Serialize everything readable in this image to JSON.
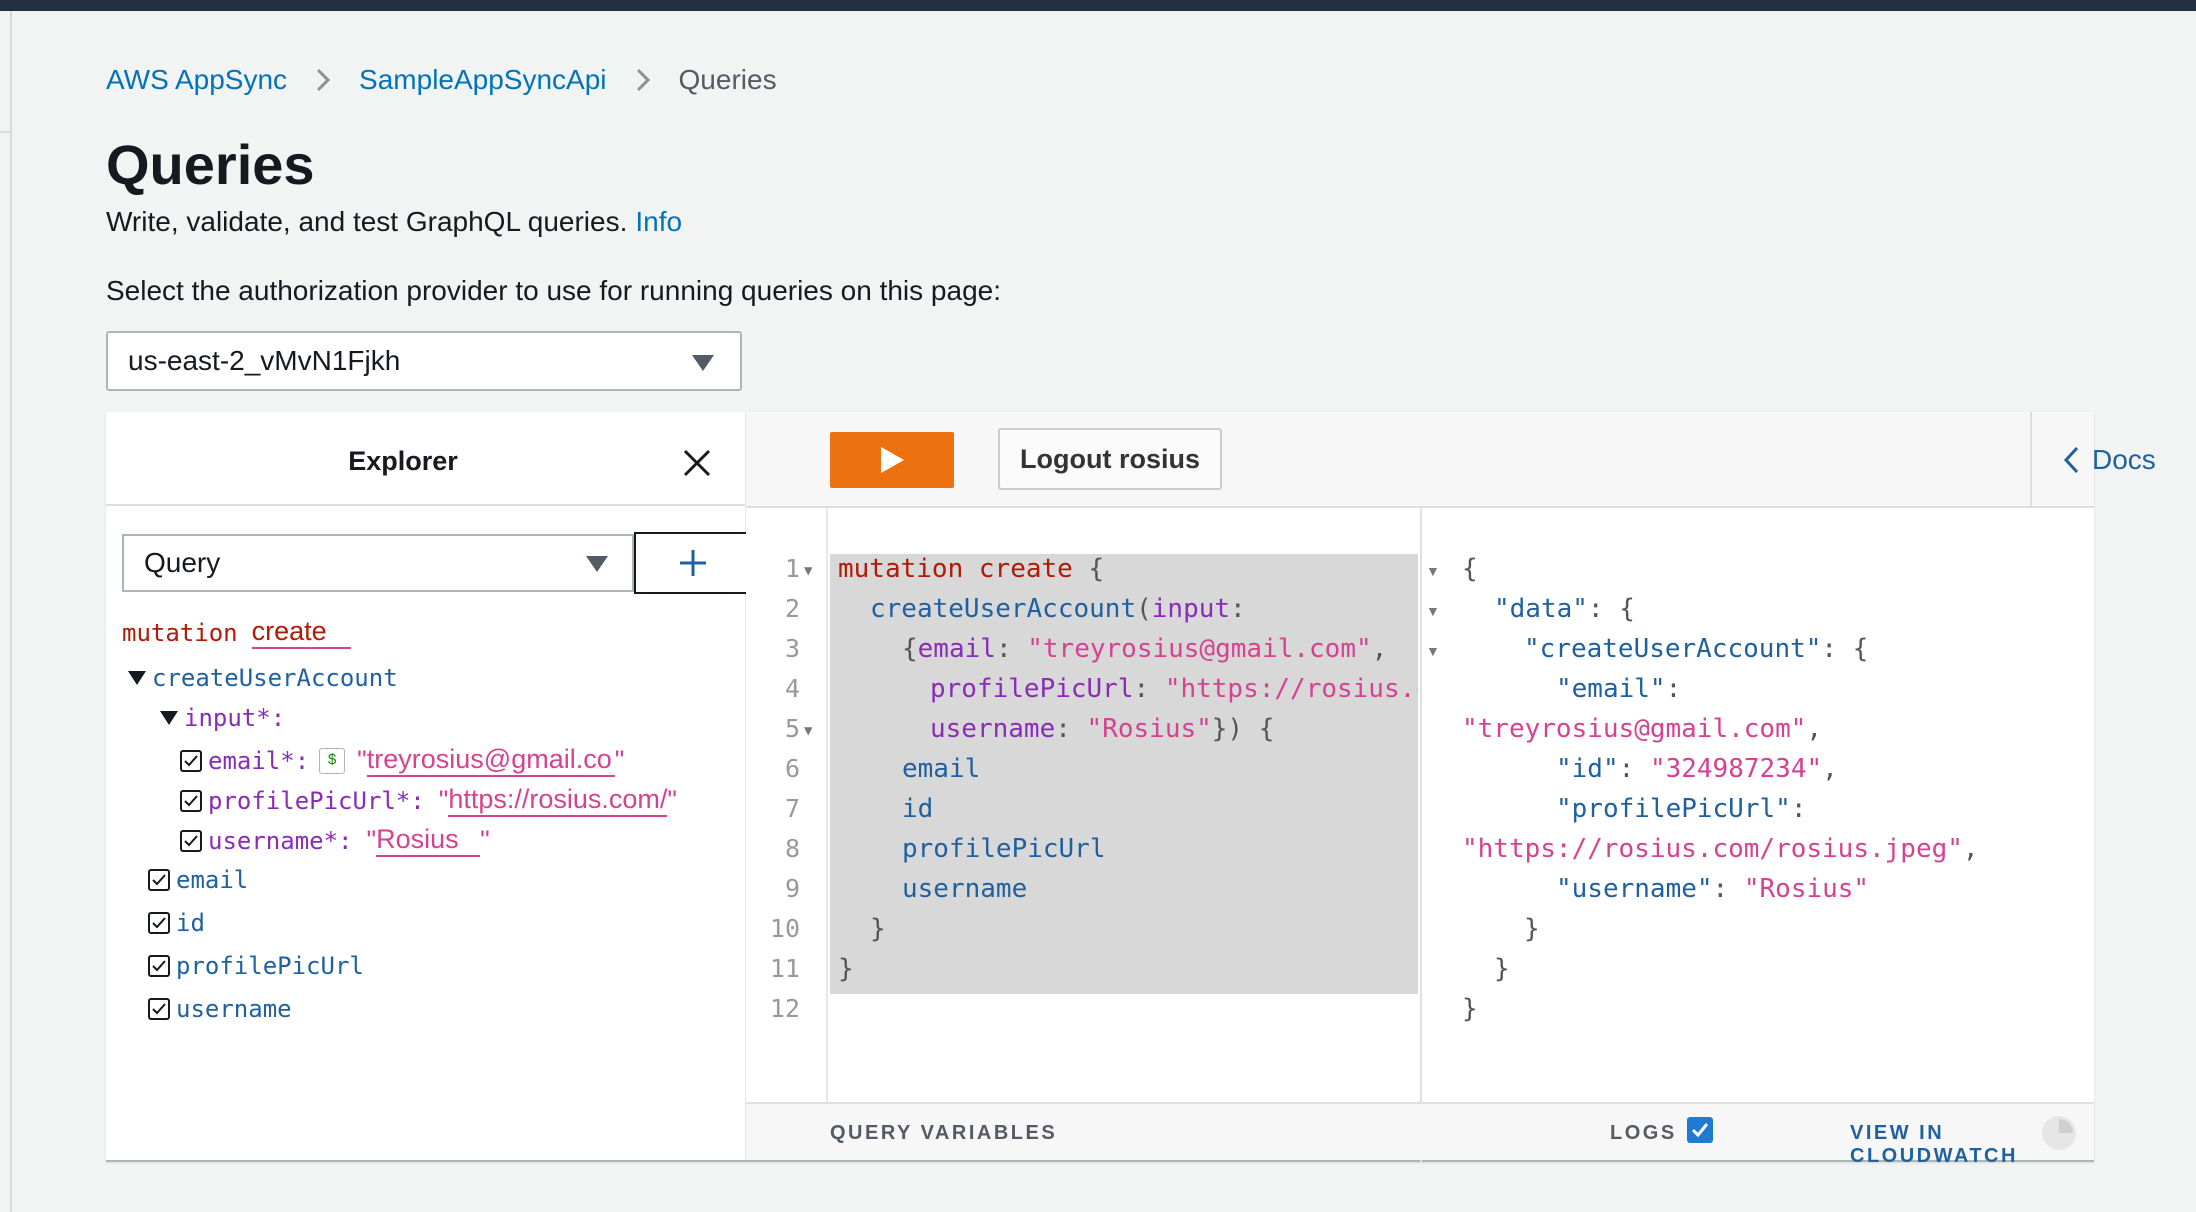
{
  "breadcrumb": {
    "items": [
      "AWS AppSync",
      "SampleAppSyncApi"
    ],
    "current": "Queries"
  },
  "page": {
    "title": "Queries",
    "subtitle": "Write, validate, and test GraphQL queries.",
    "info_link": "Info",
    "auth_label": "Select the authorization provider to use for running queries on this page:",
    "auth_value": "us-east-2_vMvN1Fjkh"
  },
  "explorer": {
    "title": "Explorer",
    "operation_type": "Query",
    "tree": {
      "op_keyword": "mutation",
      "op_name": "create",
      "field": "createUserAccount",
      "input_label": "input*:",
      "args": [
        {
          "name": "email*:",
          "value": "treyrosius@gmail.co"
        },
        {
          "name": "profilePicUrl*:",
          "value": "https://rosius.com/"
        },
        {
          "name": "username*:",
          "value": "Rosius"
        }
      ],
      "fields": [
        "email",
        "id",
        "profilePicUrl",
        "username"
      ]
    }
  },
  "toolbar": {
    "logout_label": "Logout rosius",
    "docs_label": "Docs"
  },
  "editor": {
    "line_numbers": [
      "1",
      "2",
      "3",
      "4",
      "5",
      "6",
      "7",
      "8",
      "9",
      "10",
      "11",
      "12"
    ],
    "lines": {
      "l1_kw": "mutation",
      "l1_name": "create",
      "l1_pun": " {",
      "l2_fld": "createUserAccount",
      "l2_pun": "(",
      "l2_attr": "input",
      "l2_colon": ":",
      "l3_pun": "{",
      "l3_attr": "email",
      "l3_colon": ": ",
      "l3_str": "\"treyrosius@gmail.com\"",
      "l3_comma": ",",
      "l4_attr": "profilePicUrl",
      "l4_colon": ": ",
      "l4_str": "\"https://rosius.c",
      "l5_attr": "username",
      "l5_colon": ": ",
      "l5_str": "\"Rosius\"",
      "l5_pun": "}) {",
      "l6": "email",
      "l7": "id",
      "l8": "profilePicUrl",
      "l9": "username",
      "l10": "}",
      "l11": "}"
    }
  },
  "result": {
    "l1": "{",
    "l2_key": "\"data\"",
    "l2_pun": ": {",
    "l3_key": "\"createUserAccount\"",
    "l3_pun": ": {",
    "l4_key": "\"email\"",
    "l4_pun": ":",
    "l5_str": "\"treyrosius@gmail.com\"",
    "l5_pun": ",",
    "l6_key": "\"id\"",
    "l6_pun": ": ",
    "l6_str": "\"324987234\"",
    "l6_comma": ",",
    "l7_key": "\"profilePicUrl\"",
    "l7_pun": ":",
    "l8_str": "\"https://rosius.com/rosius.jpeg\"",
    "l8_pun": ",",
    "l9_key": "\"username\"",
    "l9_pun": ": ",
    "l9_str": "\"Rosius\"",
    "l10": "}",
    "l11": "}",
    "l12": "}"
  },
  "footer": {
    "query_variables": "QUERY VARIABLES",
    "logs": "LOGS",
    "cloudwatch": "VIEW IN CLOUDWATCH"
  },
  "colors": {
    "accent": "#ec7211",
    "link": "#0073bb",
    "keyword": "#b11a04",
    "field": "#1f61a0",
    "string": "#d64292",
    "attribute": "#8b2bb9"
  }
}
